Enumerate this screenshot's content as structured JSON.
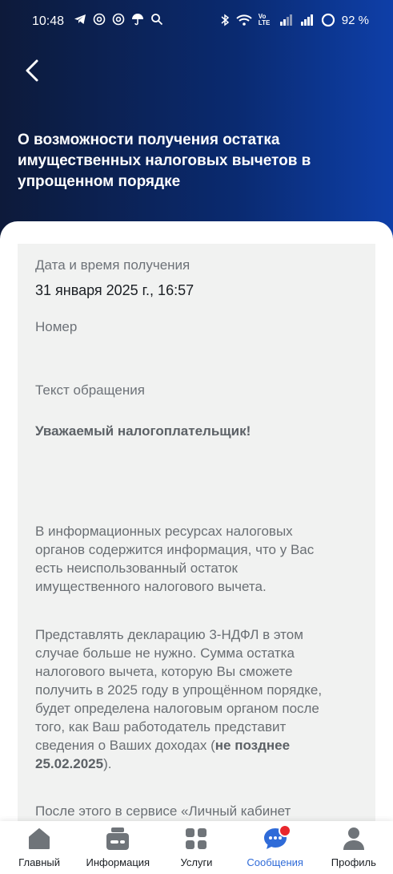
{
  "status_bar": {
    "time": "10:48",
    "battery": "92 %",
    "network_label": "Vo LTE"
  },
  "header": {
    "title": "О возможности получения остатка имущественных налоговых вычетов в упрощенном порядке"
  },
  "details": {
    "date_label": "Дата и время получения",
    "date_value": "31 января 2025 г., 16:57",
    "number_label": "Номер",
    "text_label": "Текст обращения"
  },
  "message": {
    "greeting": "Уважаемый налогоплательщик!",
    "para1": "В информационных ресурсах налоговых органов содержится информация, что у Вас есть неиспользованный остаток имущественного налогового вычета.",
    "para2_start": "Представлять декларацию 3-НДФЛ в этом случае больше не нужно. Сумма остатка налогового вычета, которую Вы сможете получить в 2025 году в упрощённом порядке, будет определена налоговым органом после того, как Ваш работодатель представит сведения о Ваших доходах (",
    "para2_bold": "не позднее 25.02.2025",
    "para2_end": ").",
    "para3": "После этого в сервисе «Личный кабинет"
  },
  "nav": {
    "items": [
      {
        "label": "Главный",
        "icon": "home-icon"
      },
      {
        "label": "Информация",
        "icon": "info-card-icon"
      },
      {
        "label": "Услуги",
        "icon": "grid-icon"
      },
      {
        "label": "Сообщения",
        "icon": "chat-icon",
        "active": true
      },
      {
        "label": "Профиль",
        "icon": "profile-icon"
      }
    ]
  },
  "colors": {
    "accent": "#2f6bd8",
    "badge": "#e8262d",
    "header_dark": "#0d1a3a",
    "header_blue": "#0e3fa8"
  }
}
